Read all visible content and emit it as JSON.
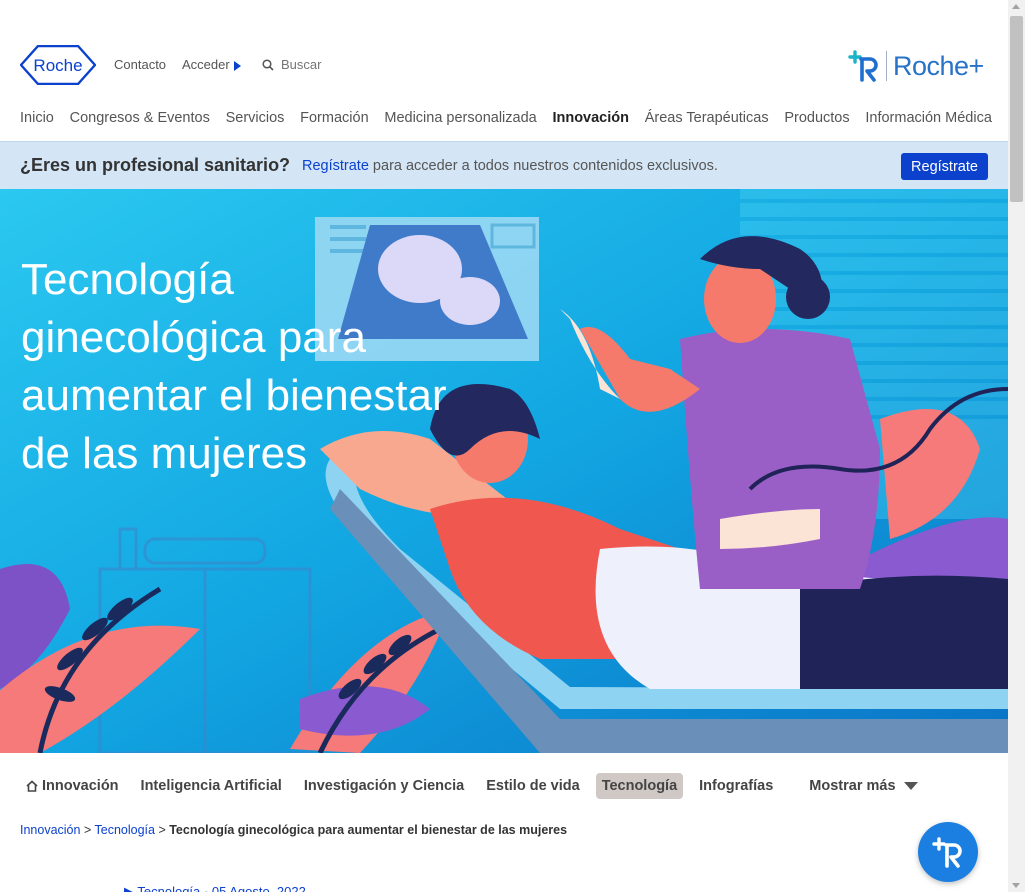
{
  "header": {
    "logo_text": "Roche",
    "contact_label": "Contacto",
    "login_label": "Acceder",
    "search_placeholder": "Buscar",
    "brand_plus_text": "Roche+"
  },
  "nav": {
    "items": [
      {
        "label": "Inicio"
      },
      {
        "label": "Congresos & Eventos"
      },
      {
        "label": "Servicios"
      },
      {
        "label": "Formación"
      },
      {
        "label": "Medicina personalizada"
      },
      {
        "label": "Innovación",
        "active": true
      },
      {
        "label": "Áreas Terapéuticas"
      },
      {
        "label": "Productos"
      },
      {
        "label": "Información Médica"
      }
    ]
  },
  "banner": {
    "question": "¿Eres un profesional sanitario?",
    "link_text": "Regístrate",
    "message": " para acceder a todos nuestros contenidos exclusivos.",
    "button_label": "Regístrate"
  },
  "hero": {
    "title": "Tecnología ginecológica para aumentar el bienestar de las mujeres"
  },
  "tabs": {
    "items": [
      {
        "label": "Innovación",
        "icon": "home-icon"
      },
      {
        "label": "Inteligencia Artificial"
      },
      {
        "label": "Investigación y Ciencia"
      },
      {
        "label": "Estilo de vida"
      },
      {
        "label": "Tecnología",
        "selected": true
      },
      {
        "label": "Infografías"
      }
    ],
    "more_label": "Mostrar más"
  },
  "breadcrumb": {
    "items": [
      "Innovación",
      "Tecnología"
    ],
    "separator": " > ",
    "current": "Tecnología ginecológica para aumentar el bienestar de las mujeres"
  },
  "article_meta": {
    "category": "Tecnología",
    "date": "05 Agosto, 2022"
  },
  "colors": {
    "primary_blue": "#0b41cd",
    "banner_bg": "#d4e6f6",
    "tab_selected_bg": "#cfc8c4",
    "fab_bg": "#1a7fe0"
  }
}
